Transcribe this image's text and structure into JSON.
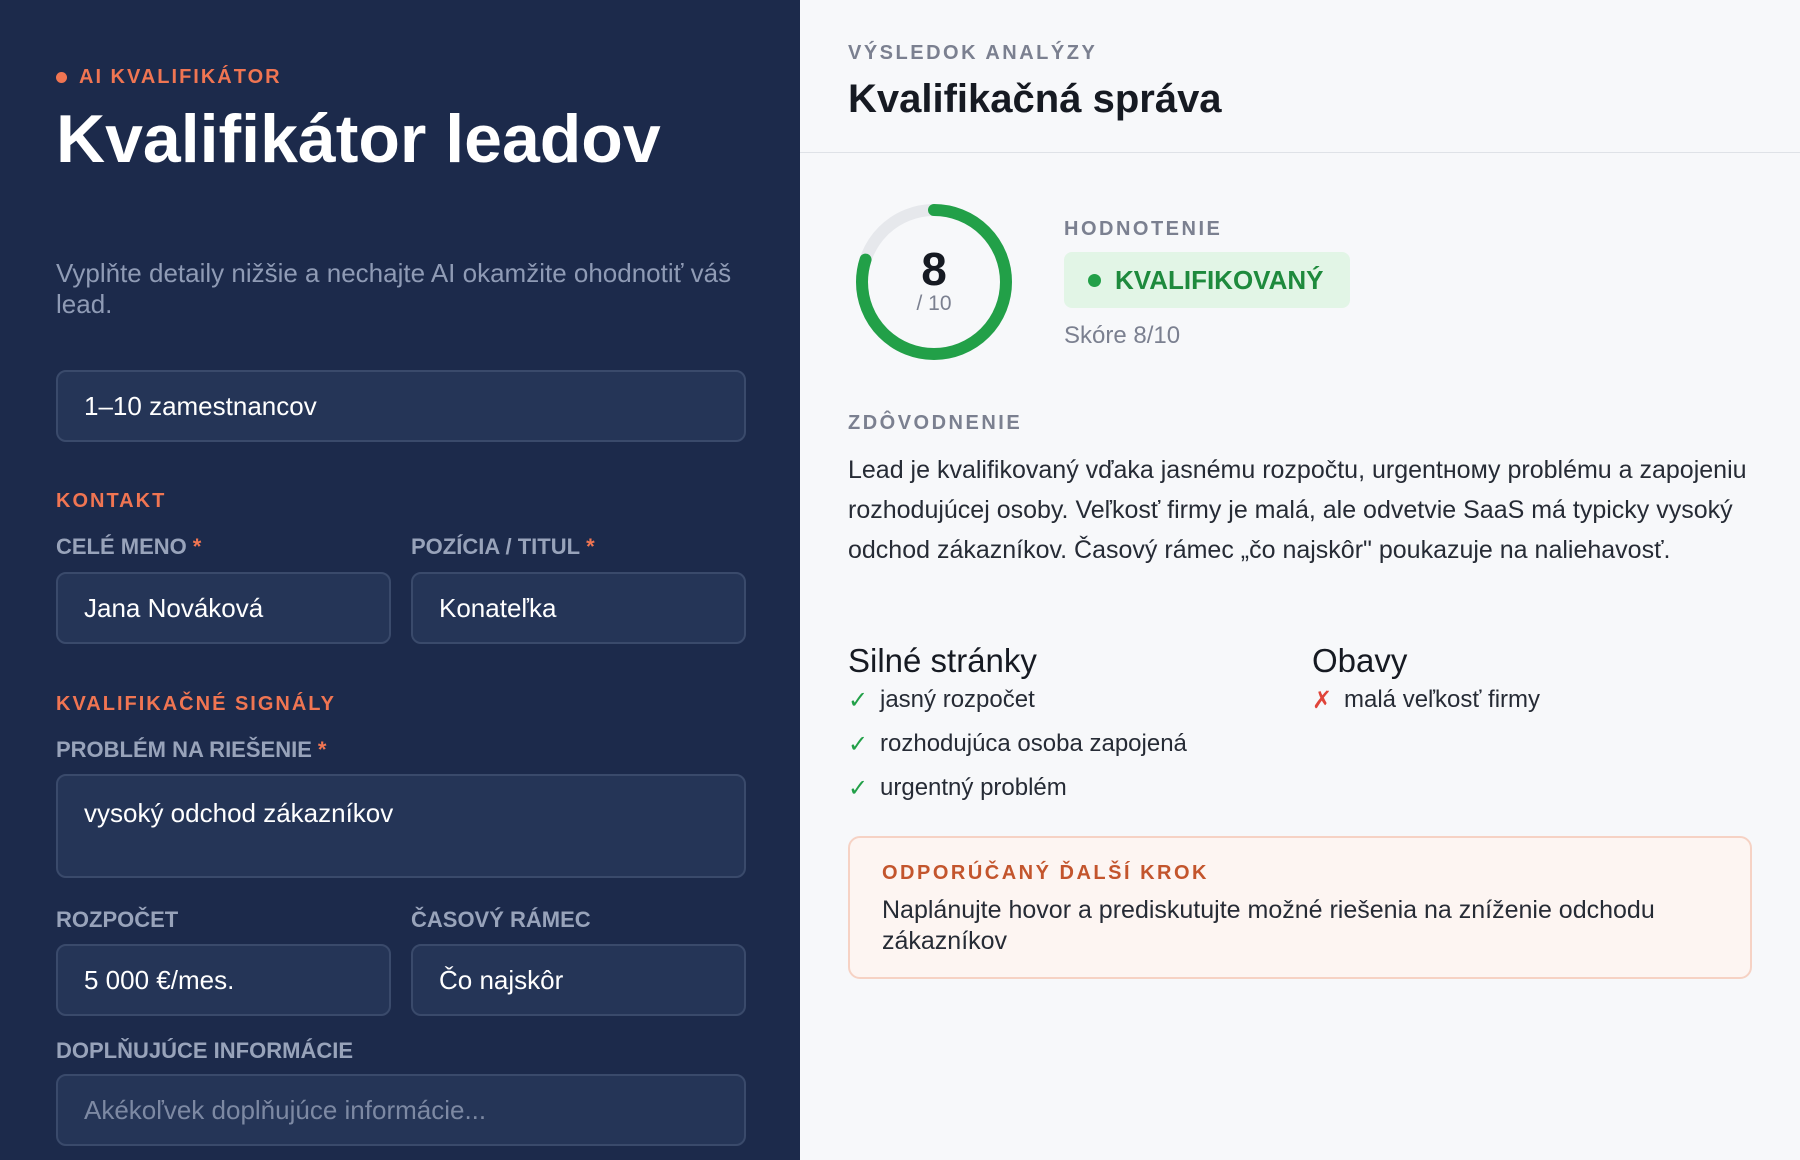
{
  "left": {
    "eyebrow": "AI KVALIFIKÁTOR",
    "title": "Kvalifikátor leadov",
    "subtitle": "Vyplňte detaily nižšie a nechajte AI okamžite ohodnotiť váš lead.",
    "company_size_value": "1–10 zamestnancov",
    "section_contact": "KONTAKT",
    "name_label": "CELÉ MENO",
    "name_value": "Jana Nováková",
    "position_label": "POZÍCIA / TITUL",
    "position_value": "Konateľka",
    "section_signals": "KVALIFIKAČNÉ SIGNÁLY",
    "problem_label": "PROBLÉM NA RIEŠENIE",
    "problem_value": "vysoký odchod zákazníkov",
    "budget_label": "ROZPOČET",
    "budget_value": "5 000 €/mes.",
    "timeframe_label": "ČASOVÝ RÁMEC",
    "timeframe_value": "Čo najskôr",
    "extra_label": "DOPLŇUJÚCE INFORMÁCIE",
    "extra_placeholder": "Akékoľvek doplňujúce informácie...",
    "required_mark": "*"
  },
  "right": {
    "eyebrow": "VÝSLEDOK ANALÝZY",
    "title": "Kvalifikačná správa",
    "score": 8,
    "score_max": 10,
    "score_number": "8",
    "score_denominator": "/ 10",
    "rating_label": "HODNOTENIE",
    "badge_text": "KVALIFIKOVANÝ",
    "score_text": "Skóre 8/10",
    "reason_label": "ZDÔVODNENIE",
    "reason_text": "Lead je kvalifikovaný vďaka jasnému rozpočtu, urgentному problému a zapojeniu rozhodujúcej osoby. Veľkosť firmy je malá, ale odvetvie SaaS má typicky vysoký odchod zákazníkov. Časový rámec „čo najskôr\" poukazuje na naliehavosť.",
    "strengths_title": "Silné stránky",
    "strengths": [
      "jasný rozpočet",
      "rozhodujúca osoba zapojená",
      "urgentný problém"
    ],
    "concerns_title": "Obavy",
    "concerns": [
      "malá veľkosť firmy"
    ],
    "next_label": "ODPORÚČANÝ ĎALŠÍ KROK",
    "next_text": "Naplánujte hovor a prediskutujte možné riešenia na zníženie odchodu zákazníkov",
    "check_mark": "✓",
    "cross_mark": "✗"
  },
  "colors": {
    "left_bg": "#1c2a4b",
    "accent": "#f07552",
    "success": "#22a048",
    "danger": "#e0453a"
  }
}
